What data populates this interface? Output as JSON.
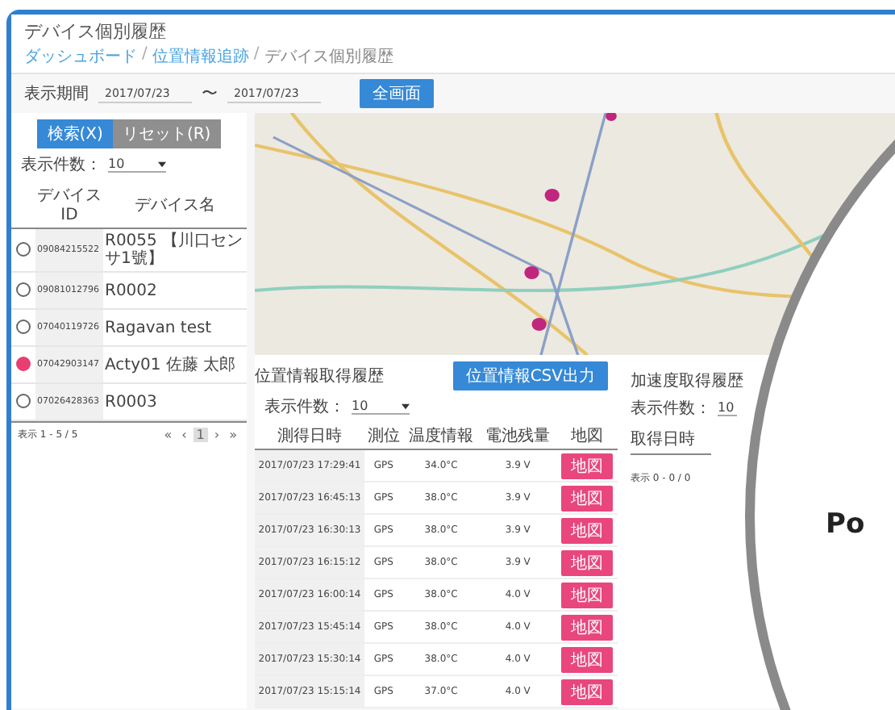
{
  "window": {
    "title": "デバイス個別履歴"
  },
  "breadcrumb": {
    "items": [
      "ダッシュボード",
      "位置情報追跡",
      "デバイス個別履歴"
    ],
    "separator": "/"
  },
  "period": {
    "label": "表示期間",
    "from": "2017/07/23",
    "separator": "〜",
    "to": "2017/07/23"
  },
  "map_button": "全画面",
  "tabs": [
    {
      "label": "検索(X)",
      "selected": true
    },
    {
      "label": "リセット(R)",
      "selected": false
    }
  ],
  "devices": {
    "page_size_label": "表示件数：",
    "page_size": "10",
    "columns": [
      "デバイス ID",
      "デバイス名"
    ],
    "rows": [
      {
        "id": "09084215522",
        "name": "R0055 【川口センサ1號】",
        "selected": false
      },
      {
        "id": "09081012796",
        "name": "R0002",
        "selected": false
      },
      {
        "id": "07040119726",
        "name": "Ragavan test",
        "selected": false
      },
      {
        "id": "07042903147",
        "name": "Acty01 佐藤 太郎",
        "selected": true
      },
      {
        "id": "07026428363",
        "name": "R0003",
        "selected": false
      }
    ],
    "footer": "表示 1 - 5 / 5",
    "pager": [
      "«",
      "‹",
      "1",
      "›",
      "»"
    ]
  },
  "location_history": {
    "title": "位置情報取得履歴",
    "csv_button": "位置情報CSV出力",
    "page_size_label": "表示件数：",
    "page_size": "10",
    "columns": [
      "測得日時",
      "測位",
      "温度情報",
      "電池残量",
      "地図"
    ],
    "rows": [
      {
        "time": "2017/07/23 17:29:41",
        "type": "GPS",
        "temp": "34.0°C",
        "battery": "3.9 V",
        "map": "地図"
      },
      {
        "time": "2017/07/23 16:45:13",
        "type": "GPS",
        "temp": "38.0°C",
        "battery": "3.9 V",
        "map": "地図"
      },
      {
        "time": "2017/07/23 16:30:13",
        "type": "GPS",
        "temp": "38.0°C",
        "battery": "3.9 V",
        "map": "地図"
      },
      {
        "time": "2017/07/23 16:15:12",
        "type": "GPS",
        "temp": "38.0°C",
        "battery": "3.9 V",
        "map": "地図"
      },
      {
        "time": "2017/07/23 16:00:14",
        "type": "GPS",
        "temp": "38.0°C",
        "battery": "4.0 V",
        "map": "地図"
      },
      {
        "time": "2017/07/23 15:45:14",
        "type": "GPS",
        "temp": "38.0°C",
        "battery": "4.0 V",
        "map": "地図"
      },
      {
        "time": "2017/07/23 15:30:14",
        "type": "GPS",
        "temp": "38.0°C",
        "battery": "4.0 V",
        "map": "地図"
      },
      {
        "time": "2017/07/23 15:15:14",
        "type": "GPS",
        "temp": "37.0°C",
        "battery": "4.0 V",
        "map": "地図"
      }
    ]
  },
  "accel_history": {
    "title": "加速度取得履歴",
    "page_size_label": "表示件数：",
    "page_size": "10",
    "columns": [
      "取得日時"
    ],
    "footer": "表示 0 - 0 / 0"
  },
  "overlay": {
    "text": "Po"
  }
}
